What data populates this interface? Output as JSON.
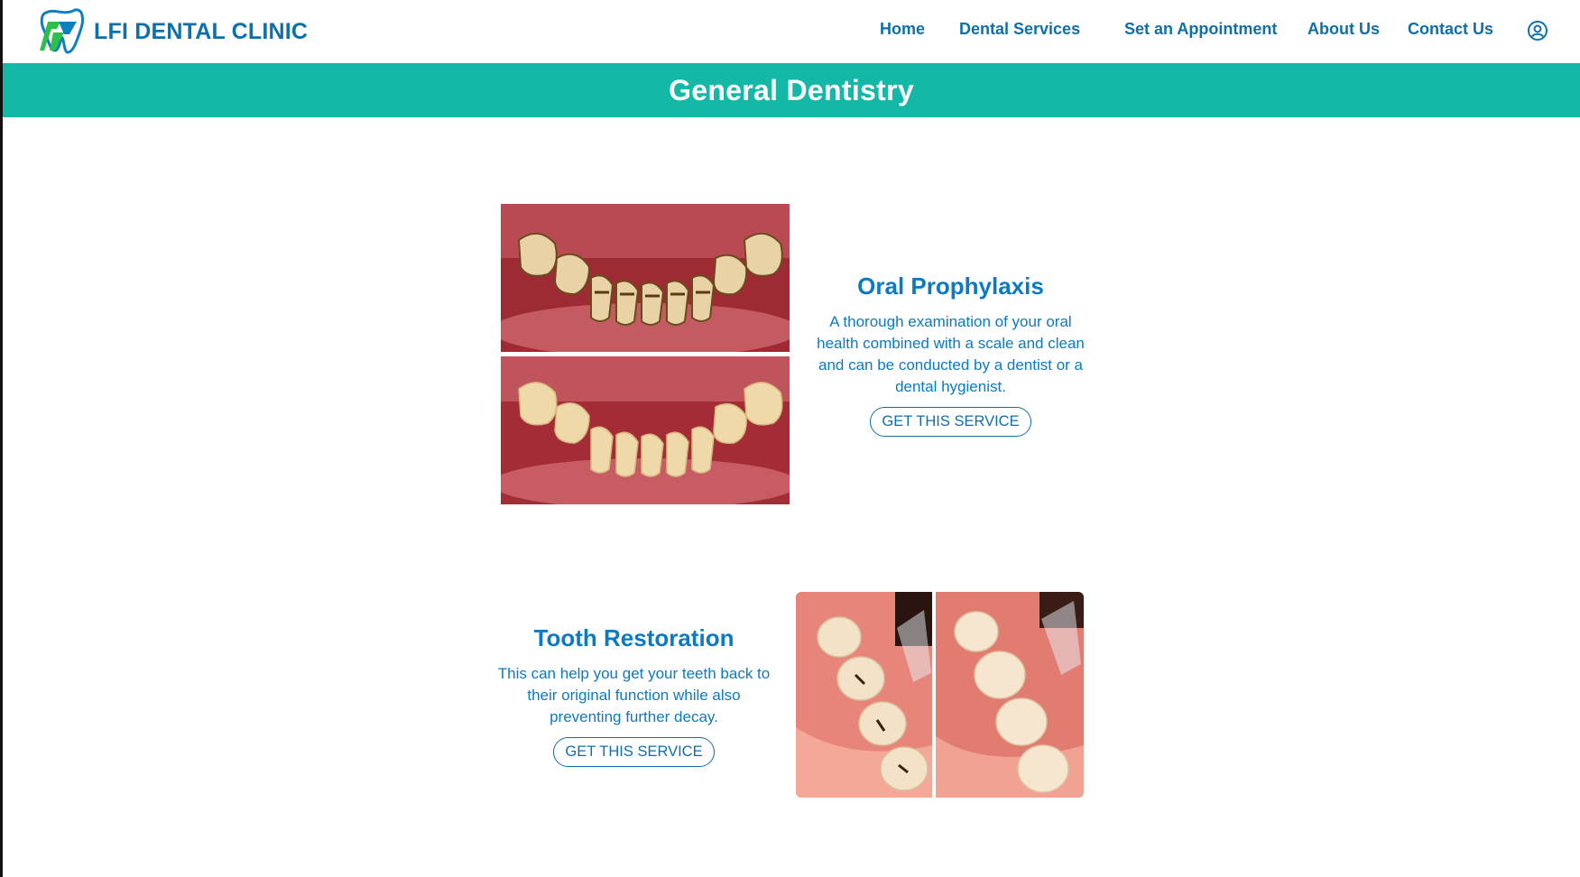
{
  "header": {
    "brand_name": "LFI DENTAL CLINIC",
    "logo_icon": "tooth-logo-icon",
    "nav": [
      {
        "label": "Home"
      },
      {
        "label": "Dental Services"
      },
      {
        "label": "Set an Appointment"
      },
      {
        "label": "About Us"
      },
      {
        "label": "Contact Us"
      }
    ],
    "user_icon": "user-circle-icon"
  },
  "banner": {
    "title": "General Dentistry"
  },
  "services": [
    {
      "title": "Oral Prophylaxis",
      "description": "A thorough examination of your oral health combined with a scale and clean and can be conducted by a dentist or a dental hygienist.",
      "button_label": "GET THIS SERVICE",
      "image": "before-after-teeth-cleaning-photo"
    },
    {
      "title": "Tooth Restoration",
      "description": "This can help you get your teeth back to their original function while also preventing further decay.",
      "button_label": "GET THIS SERVICE",
      "image": "before-after-tooth-filling-photo"
    }
  ],
  "colors": {
    "brand_blue": "#0f6fa8",
    "heading_blue": "#0c7ac2",
    "teal_banner": "#14b8a6",
    "logo_green": "#2dbf4a"
  }
}
